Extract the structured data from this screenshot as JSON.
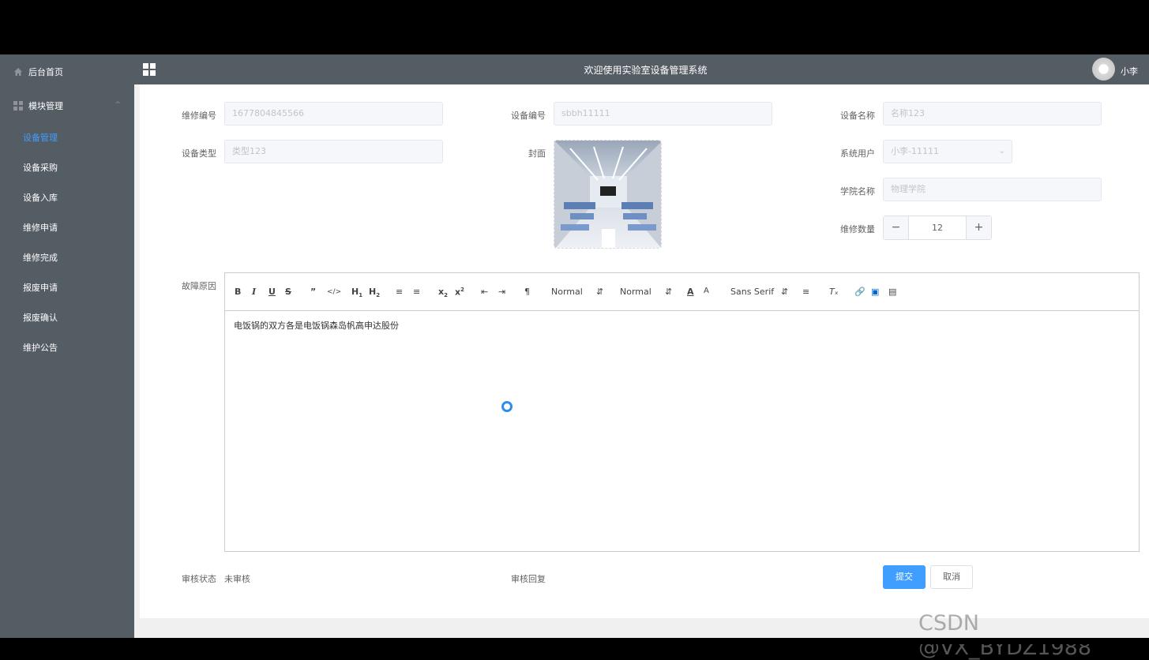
{
  "header": {
    "title": "欢迎使用实验室设备管理系统",
    "username": "小李"
  },
  "sidebar": {
    "home": "后台首页",
    "module": "模块管理",
    "items": [
      {
        "label": "设备管理"
      },
      {
        "label": "设备采购"
      },
      {
        "label": "设备入库"
      },
      {
        "label": "维修申请"
      },
      {
        "label": "维修完成"
      },
      {
        "label": "报废申请"
      },
      {
        "label": "报废确认"
      },
      {
        "label": "维护公告"
      }
    ]
  },
  "form": {
    "repair_no": {
      "label": "维修编号",
      "value": "1677804845566"
    },
    "device_no": {
      "label": "设备编号",
      "value": "sbbh11111"
    },
    "device_name": {
      "label": "设备名称",
      "value": "名称123"
    },
    "device_type": {
      "label": "设备类型",
      "value": "类型123"
    },
    "cover": {
      "label": "封面"
    },
    "system_user": {
      "label": "系统用户",
      "value": "小李-11111"
    },
    "college": {
      "label": "学院名称",
      "value": "物理学院"
    },
    "repair_qty": {
      "label": "维修数量",
      "value": "12"
    },
    "fault": {
      "label": "故障原因",
      "content": "电饭锅的双方各是电饭锅森岛帆高申达股份"
    },
    "audit_status": {
      "label": "审核状态",
      "value": "未审核"
    },
    "audit_reply": {
      "label": "审核回复"
    }
  },
  "editor_toolbar": {
    "header_select": "Normal",
    "size_select": "Normal",
    "font_select": "Sans Serif"
  },
  "buttons": {
    "submit": "提交",
    "cancel": "取消"
  },
  "watermark": "CSDN @VX_BYDZ1988",
  "colors": {
    "sidebar": "#545c64",
    "accent": "#409eff"
  }
}
